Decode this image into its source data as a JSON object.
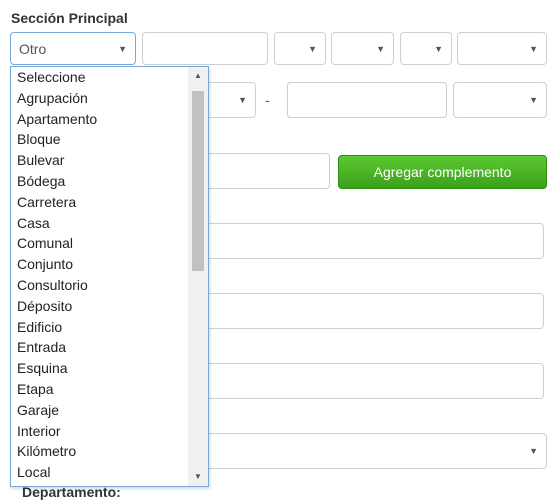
{
  "section_title": "Sección Principal",
  "via_type_select": {
    "selected": "Otro"
  },
  "dash": "-",
  "add_complement_button": "Agregar complemento",
  "department_label": "Departamento:",
  "icons": {
    "dropdown": "chevron-down-icon",
    "scroll_up": "triangle-up-icon",
    "scroll_down": "triangle-down-icon"
  },
  "colors": {
    "accent_green": "#43b022",
    "focus_blue": "#7aa7d9"
  },
  "dropdown": {
    "options": [
      "Seleccione",
      "Agrupación",
      "Apartamento",
      "Bloque",
      "Bulevar",
      "Bódega",
      "Carretera",
      "Casa",
      "Comunal",
      "Conjunto",
      "Consultorio",
      "Déposito",
      "Edificio",
      "Entrada",
      "Esquina",
      "Etapa",
      "Garaje",
      "Interior",
      "Kilómetro",
      "Local"
    ]
  }
}
